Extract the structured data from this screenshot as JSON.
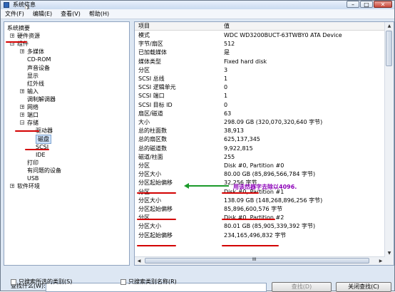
{
  "window": {
    "title": "系统信息",
    "buttons": {
      "min": "–",
      "max": "□",
      "close": "✕"
    }
  },
  "menu": [
    "文件(F)",
    "编辑(E)",
    "查看(V)",
    "帮助(H)"
  ],
  "tree": [
    {
      "label": "系统摘要",
      "level": 0,
      "box": ""
    },
    {
      "label": "硬件资源",
      "level": 1,
      "box": "+"
    },
    {
      "label": "组件",
      "level": 1,
      "box": "−"
    },
    {
      "label": "多媒体",
      "level": 2,
      "box": "+"
    },
    {
      "label": "CD-ROM",
      "level": 2,
      "box": ""
    },
    {
      "label": "声音设备",
      "level": 2,
      "box": ""
    },
    {
      "label": "显示",
      "level": 2,
      "box": ""
    },
    {
      "label": "红外线",
      "level": 2,
      "box": ""
    },
    {
      "label": "输入",
      "level": 2,
      "box": "+"
    },
    {
      "label": "调制解调器",
      "level": 2,
      "box": ""
    },
    {
      "label": "网络",
      "level": 2,
      "box": "+"
    },
    {
      "label": "端口",
      "level": 2,
      "box": "+"
    },
    {
      "label": "存储",
      "level": 2,
      "box": "−"
    },
    {
      "label": "驱动器",
      "level": 3,
      "box": ""
    },
    {
      "label": "磁盘",
      "level": 3,
      "box": "",
      "selected": true
    },
    {
      "label": "SCSI",
      "level": 3,
      "box": ""
    },
    {
      "label": "IDE",
      "level": 3,
      "box": ""
    },
    {
      "label": "打印",
      "level": 2,
      "box": ""
    },
    {
      "label": "有问题的设备",
      "level": 2,
      "box": ""
    },
    {
      "label": "USB",
      "level": 2,
      "box": ""
    },
    {
      "label": "软件环境",
      "level": 1,
      "box": "+"
    }
  ],
  "table": {
    "headers": {
      "key": "项目",
      "value": "值"
    },
    "rows": [
      [
        "模式",
        "WDC WD3200BUCT-63TWBY0 ATA Device"
      ],
      [
        "字节/扇区",
        "512"
      ],
      [
        "已加载媒体",
        "是"
      ],
      [
        "媒体类型",
        "Fixed hard disk"
      ],
      [
        "分区",
        "3"
      ],
      [
        "SCSI 总线",
        "1"
      ],
      [
        "SCSI 逻辑单元",
        "0"
      ],
      [
        "SCSI 端口",
        "1"
      ],
      [
        "SCSI 目标 ID",
        "0"
      ],
      [
        "扇区/磁道",
        "63"
      ],
      [
        "大小",
        "298.09 GB (320,070,320,640 字节)"
      ],
      [
        "总的柱面数",
        "38,913"
      ],
      [
        "总的扇区数",
        "625,137,345"
      ],
      [
        "总的磁道数",
        "9,922,815"
      ],
      [
        "磁道/柱面",
        "255"
      ],
      [
        "分区",
        "Disk #0, Partition #0"
      ],
      [
        "分区大小",
        "80.00 GB (85,896,566,784 字节)"
      ],
      [
        "分区起始偏移",
        "32,256 字节"
      ],
      [
        "分区",
        "Disk #0, Partition #1"
      ],
      [
        "分区大小",
        "138.09 GB (148,268,896,256 字节)"
      ],
      [
        "分区起始偏移",
        "85,896,600,576 字节"
      ],
      [
        "分区",
        "Disk #0, Partition #2"
      ],
      [
        "分区大小",
        "80.01 GB (85,905,339,392 字节)"
      ],
      [
        "分区起始偏移",
        "234,165,496,832 字节"
      ]
    ]
  },
  "annotation": "用该然器字去除以4096.",
  "scroll": {
    "horizontal_label": "III"
  },
  "find": {
    "label": "查找什么(W):",
    "value": "",
    "find_button": "查找(D)",
    "close_find_button": "关闭查找(C)",
    "check_selected_only": "只搜索所选的类别(S)",
    "check_names_only": "只搜索类别名称(R)"
  },
  "colors": {
    "annotation_red": "#d30000",
    "annotation_purple": "#8c00b8",
    "arrow_green": "#1b9a2a"
  }
}
